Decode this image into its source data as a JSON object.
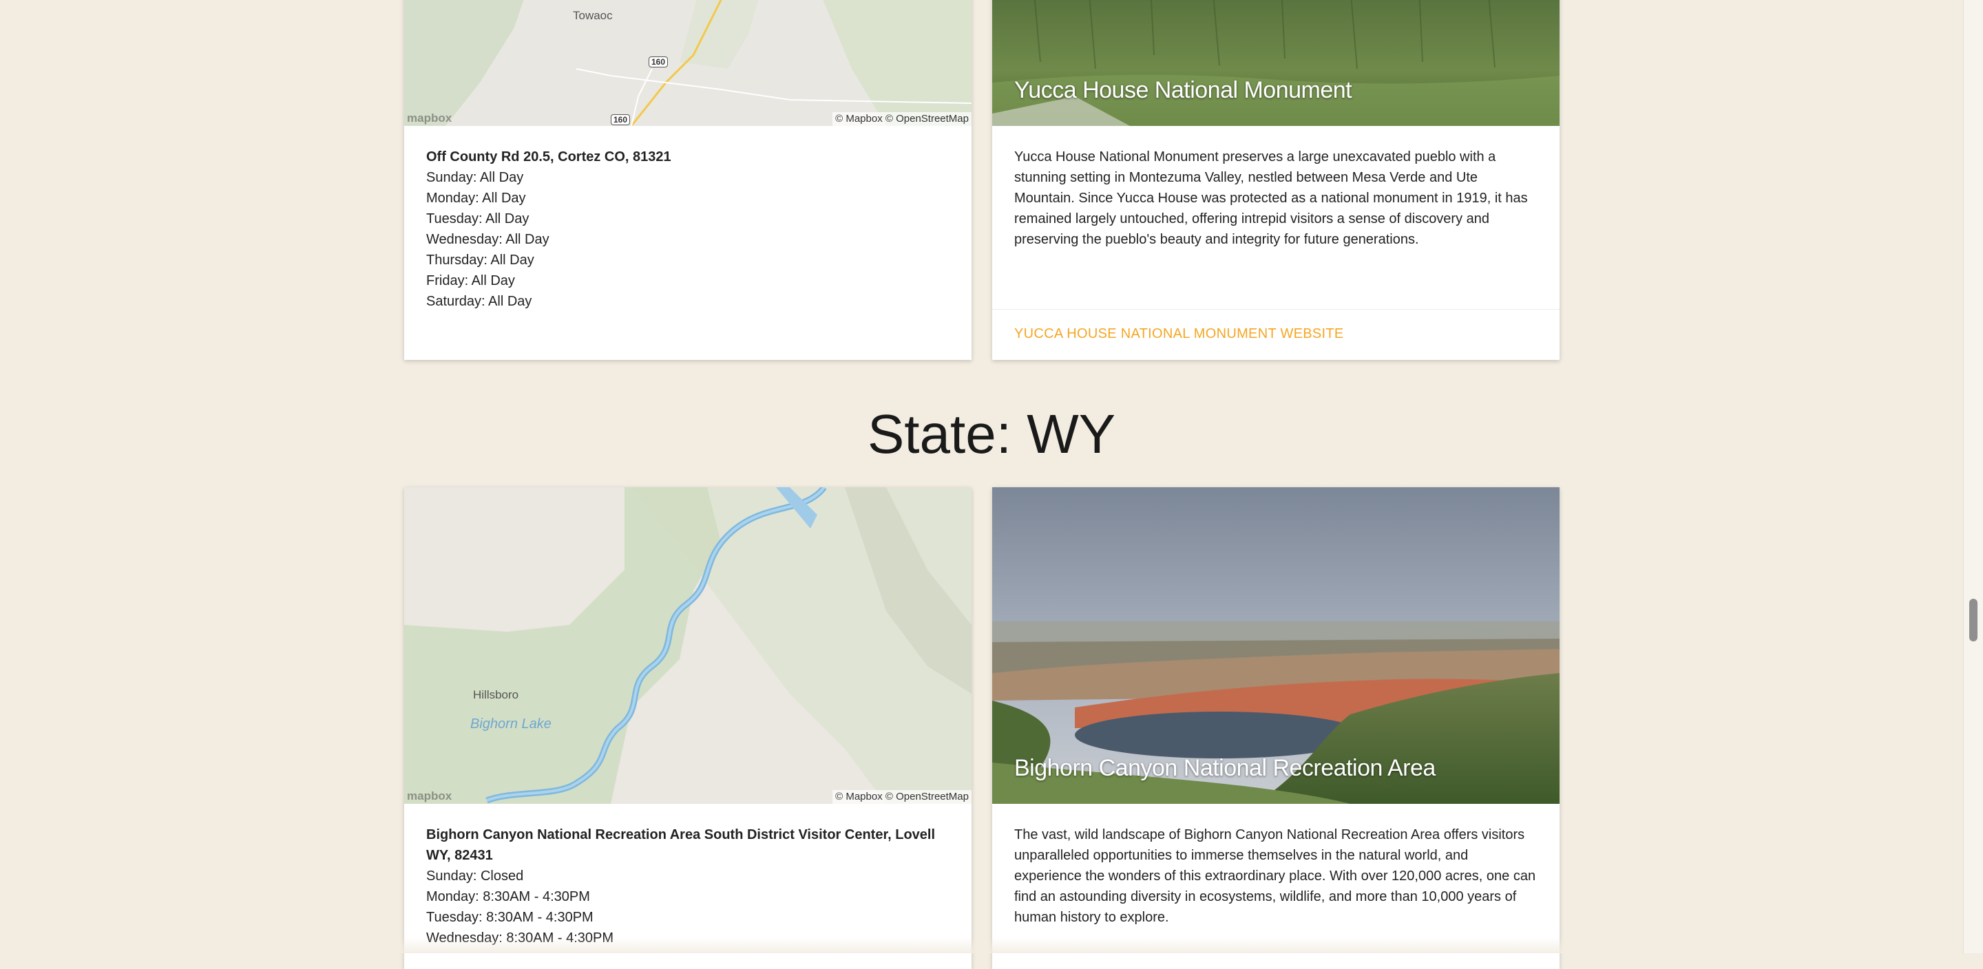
{
  "sections": [
    {
      "state_heading": "",
      "map_card": {
        "map_labels": [
          "Towaoc",
          "160",
          "160"
        ],
        "map_logo": "mapbox",
        "map_credit": "© Mapbox © OpenStreetMap",
        "address": "Off County Rd 20.5, Cortez CO, 81321",
        "hours": [
          "Sunday: All Day",
          "Monday: All Day",
          "Tuesday: All Day",
          "Wednesday: All Day",
          "Thursday: All Day",
          "Friday: All Day",
          "Saturday: All Day"
        ]
      },
      "info_card": {
        "title": "Yucca House National Monument",
        "description": "Yucca House National Monument preserves a large unexcavated pueblo with a stunning setting in Montezuma Valley, nestled between Mesa Verde and Ute Mountain. Since Yucca House was protected as a national monument in 1919, it has remained largely untouched, offering intrepid visitors a sense of discovery and preserving the pueblo's beauty and integrity for future generations.",
        "website_link": "YUCCA HOUSE NATIONAL MONUMENT WEBSITE"
      }
    },
    {
      "state_heading": "State: WY",
      "map_card": {
        "map_labels": [
          "Hillsboro",
          "Bighorn Lake"
        ],
        "map_logo": "mapbox",
        "map_credit": "© Mapbox © OpenStreetMap",
        "address": "Bighorn Canyon National Recreation Area South District Visitor Center, Lovell WY, 82431",
        "hours": [
          "Sunday: Closed",
          "Monday: 8:30AM - 4:30PM",
          "Tuesday: 8:30AM - 4:30PM",
          "Wednesday: 8:30AM - 4:30PM"
        ]
      },
      "info_card": {
        "title": "Bighorn Canyon National Recreation Area",
        "description": "The vast, wild landscape of Bighorn Canyon National Recreation Area offers visitors unparalleled opportunities to immerse themselves in the natural world, and experience the wonders of this extraordinary place. With over 120,000 acres, one can find an astounding diversity in ecosystems, wildlife, and more than 10,000 years of human history to explore."
      }
    }
  ],
  "colors": {
    "page_background": "#f2ece1",
    "link_accent": "#f5a623",
    "card_background": "#ffffff"
  }
}
